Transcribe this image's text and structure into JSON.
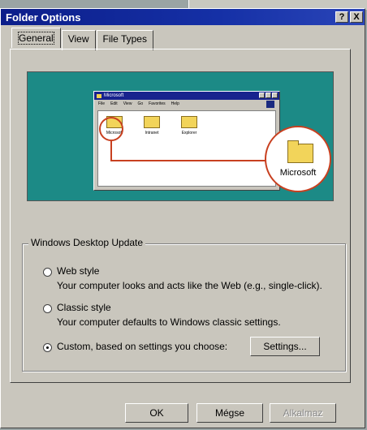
{
  "window": {
    "title": "Folder Options",
    "help_btn": "?",
    "close_btn": "X"
  },
  "tabs": [
    {
      "label": "General",
      "active": true
    },
    {
      "label": "View",
      "active": false
    },
    {
      "label": "File Types",
      "active": false
    }
  ],
  "preview": {
    "mini_title": "Microsoft",
    "mini_menu": [
      "File",
      "Edit",
      "View",
      "Go",
      "Favorites",
      "Help"
    ],
    "mini_folders": [
      "Microsoft",
      "Intranet",
      "Explorer"
    ],
    "zoom_label": "Microsoft"
  },
  "group": {
    "label": "Windows Desktop Update"
  },
  "options": [
    {
      "label": "Web style",
      "desc": "Your computer looks and acts like the Web (e.g., single-click).",
      "selected": false
    },
    {
      "label": "Classic style",
      "desc": "Your computer defaults to Windows classic settings.",
      "selected": false
    },
    {
      "label": "Custom, based on settings you choose:",
      "desc": "",
      "selected": true
    }
  ],
  "settings_button": "Settings...",
  "footer": {
    "ok": "OK",
    "cancel": "Mégse",
    "apply": "Alkalmaz"
  }
}
